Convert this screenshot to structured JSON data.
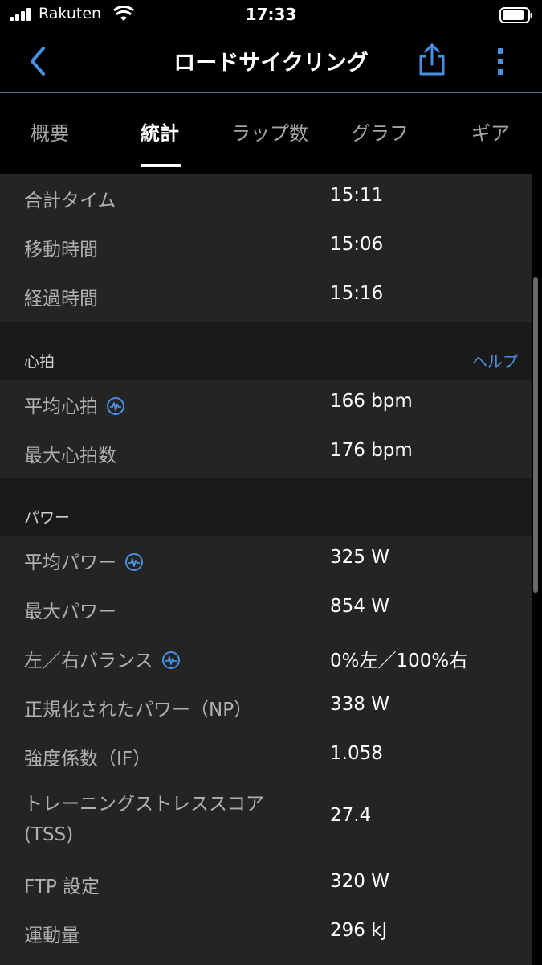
{
  "status_bar": {
    "carrier": "Rakuten",
    "time": "17:33"
  },
  "nav": {
    "title": "ロードサイクリング"
  },
  "tabs": [
    "概要",
    "統計",
    "ラップ数",
    "グラフ",
    "ギア"
  ],
  "active_tab": "統計",
  "time_section": {
    "rows": [
      {
        "key": "合計タイム",
        "value": "15:11"
      },
      {
        "key": "移動時間",
        "value": "15:06"
      },
      {
        "key": "経過時間",
        "value": "15:16"
      }
    ]
  },
  "heart_section": {
    "title": "心拍",
    "help": "ヘルプ",
    "rows": [
      {
        "key": "平均心拍",
        "value": "166 bpm",
        "info_icon": true
      },
      {
        "key": "最大心拍数",
        "value": "176 bpm"
      }
    ]
  },
  "power_section": {
    "title": "パワー",
    "rows": [
      {
        "key": "平均パワー",
        "value": "325 W",
        "info_icon": true
      },
      {
        "key": "最大パワー",
        "value": "854 W"
      },
      {
        "key": "左／右バランス",
        "value": "0%左／100%右",
        "info_icon": true
      },
      {
        "key": "正規化されたパワー（NP）",
        "value": "338 W"
      },
      {
        "key": "強度係数（IF）",
        "value": "1.058"
      },
      {
        "key": "トレーニングストレススコア(TSS)",
        "value": "27.4"
      },
      {
        "key": "FTP 設定",
        "value": "320 W"
      },
      {
        "key": "運動量",
        "value": "296 kJ"
      }
    ]
  },
  "colors": {
    "accent": "#4a90e2",
    "background": "#000000",
    "row_bg": "#242424",
    "header_bg": "#1a1a1a"
  },
  "icons": {
    "back": "chevron-left-icon",
    "share": "share-icon",
    "more": "more-vertical-icon",
    "info": "heart-rate-info-icon"
  }
}
